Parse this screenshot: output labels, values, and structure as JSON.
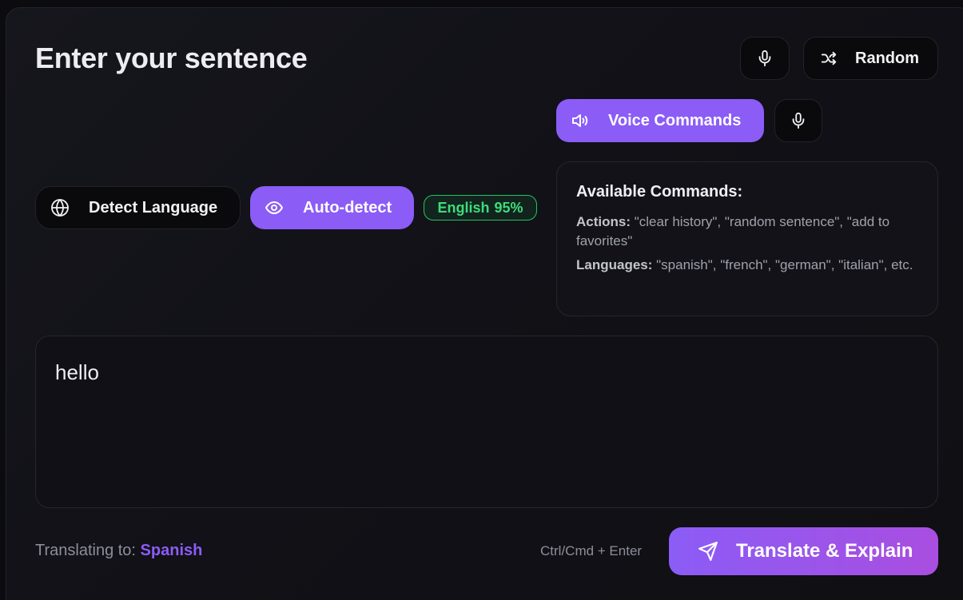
{
  "header": {
    "title": "Enter your sentence",
    "mic_icon": "microphone-icon",
    "random_label": "Random",
    "random_icon": "shuffle-icon"
  },
  "voice": {
    "label": "Voice Commands",
    "icon": "speaker-icon",
    "mic_icon": "microphone-icon"
  },
  "detect": {
    "detect_label": "Detect Language",
    "detect_icon": "globe-icon",
    "auto_label": "Auto-detect",
    "auto_icon": "eye-icon",
    "badge_language": "English",
    "badge_confidence": "95%"
  },
  "commands": {
    "title": "Available Commands:",
    "actions_label": "Actions:",
    "actions_text": " \"clear history\", \"random sentence\", \"add to favorites\"",
    "languages_label": "Languages:",
    "languages_text": " \"spanish\", \"french\", \"german\", \"italian\", etc."
  },
  "input": {
    "value": "hello"
  },
  "footer": {
    "translating_label": "Translating to: ",
    "target_language": "Spanish",
    "shortcut": "Ctrl/Cmd + Enter",
    "submit_label": "Translate & Explain",
    "submit_icon": "send-icon"
  },
  "colors": {
    "accent": "#8b5cf6",
    "badge_green": "#22c55e",
    "background": "#0b0b10"
  }
}
